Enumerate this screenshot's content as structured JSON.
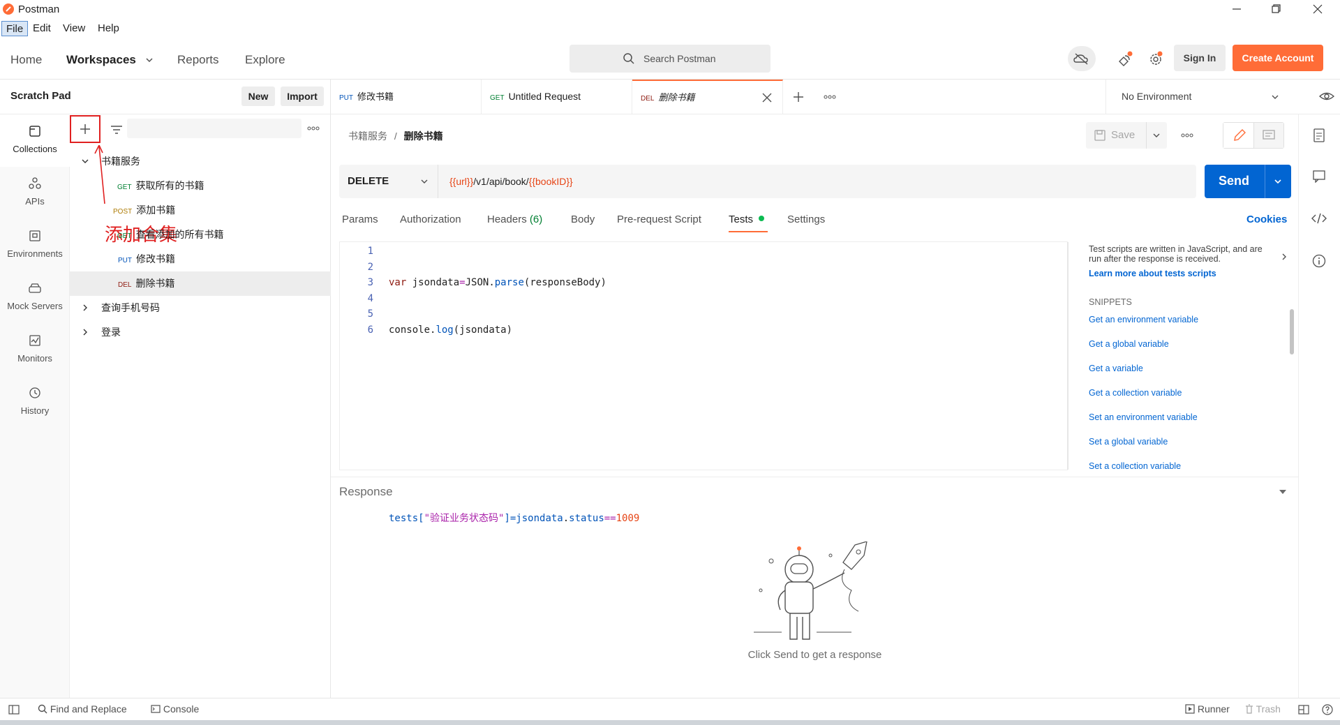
{
  "window": {
    "title": "Postman",
    "menu": [
      "File",
      "Edit",
      "View",
      "Help"
    ]
  },
  "header": {
    "nav": {
      "home": "Home",
      "workspaces": "Workspaces",
      "reports": "Reports",
      "explore": "Explore"
    },
    "search_placeholder": "Search Postman",
    "sign_in": "Sign In",
    "create_account": "Create Account"
  },
  "sidebar": {
    "title": "Scratch Pad",
    "new_label": "New",
    "import_label": "Import",
    "items": [
      {
        "label": "Collections",
        "icon": "collections-icon"
      },
      {
        "label": "APIs",
        "icon": "apis-icon"
      },
      {
        "label": "Environments",
        "icon": "environments-icon"
      },
      {
        "label": "Mock Servers",
        "icon": "mock-servers-icon"
      },
      {
        "label": "Monitors",
        "icon": "monitors-icon"
      },
      {
        "label": "History",
        "icon": "history-icon"
      }
    ],
    "annotation": "添加合集",
    "tree": [
      {
        "label": "书籍服务",
        "expanded": true
      },
      {
        "method": "GET",
        "label": "获取所有的书籍"
      },
      {
        "method": "POST",
        "label": "添加书籍"
      },
      {
        "method": "GET",
        "label": "查看添加的所有书籍"
      },
      {
        "method": "PUT",
        "label": "修改书籍"
      },
      {
        "method": "DEL",
        "label": "删除书籍",
        "selected": true
      },
      {
        "label": "查询手机号码",
        "expanded": false
      },
      {
        "label": "登录",
        "expanded": false
      }
    ]
  },
  "tabs": [
    {
      "method": "PUT",
      "label": "修改书籍"
    },
    {
      "method": "GET",
      "label": "Untitled Request"
    },
    {
      "method": "DEL",
      "label": "删除书籍",
      "active": true
    }
  ],
  "environment": {
    "selected": "No Environment"
  },
  "request": {
    "breadcrumb_parent": "书籍服务",
    "breadcrumb_current": "删除书籍",
    "save_label": "Save",
    "method": "DELETE",
    "url_var1": "{{url}}",
    "url_path": "/v1/api/book/",
    "url_var2": "{{bookID}}",
    "send_label": "Send",
    "subtabs": {
      "params": "Params",
      "authorization": "Authorization",
      "headers": "Headers",
      "headers_count": "(6)",
      "body": "Body",
      "prerequest": "Pre-request Script",
      "tests": "Tests",
      "settings": "Settings"
    },
    "cookies": "Cookies"
  },
  "editor": {
    "line_numbers": [
      "1",
      "2",
      "3",
      "4",
      "5",
      "6"
    ],
    "line1": {
      "kw": "var",
      "ident": " jsondata",
      "op": "=",
      "obj": "JSON",
      "dot": ".",
      "fn": "parse",
      "args": "(responseBody)"
    },
    "line2": {
      "obj": "console",
      "dot": ".",
      "fn": "log",
      "args": "(jsondata)"
    },
    "line6": {
      "a": "tests[",
      "str": "\"验证业务状态码\"",
      "b": "]=jsondata",
      "dot": ".",
      "prop": "status",
      "op": "==",
      "num": "1009"
    }
  },
  "snippets_panel": {
    "intro": "Test scripts are written in JavaScript, and are run after the response is received.",
    "learn_more": "Learn more about tests scripts",
    "heading": "SNIPPETS",
    "items": [
      "Get an environment variable",
      "Get a global variable",
      "Get a variable",
      "Get a collection variable",
      "Set an environment variable",
      "Set a global variable",
      "Set a collection variable"
    ]
  },
  "response": {
    "title": "Response",
    "empty_text": "Click Send to get a response"
  },
  "footer": {
    "find_replace": "Find and Replace",
    "console": "Console",
    "runner": "Runner",
    "trash": "Trash"
  },
  "colors": {
    "accent": "#ff6c37",
    "send_blue": "#0265d2",
    "annotation_red": "#e02020",
    "tests_dot": "#0cbb52"
  }
}
